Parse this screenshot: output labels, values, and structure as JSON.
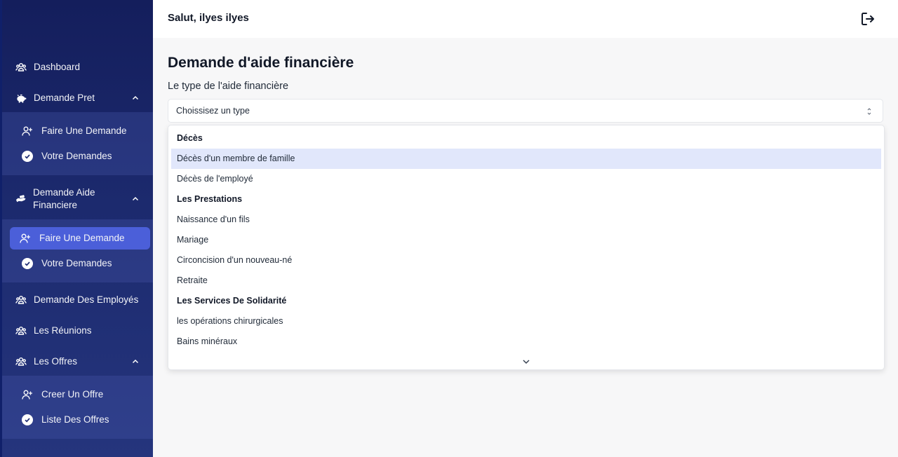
{
  "header": {
    "greeting": "Salut, ilyes ilyes",
    "logout_icon": "logout-icon"
  },
  "sidebar": {
    "items": [
      {
        "label": "Dashboard",
        "icon": "users-icon"
      },
      {
        "label": "Demande Pret",
        "icon": "piggy-bank-icon",
        "expanded": true
      },
      {
        "label": "Demande Aide Financiere",
        "icon": "hand-money-icon",
        "expanded": true
      },
      {
        "label": "Demande Des Employés",
        "icon": "users-icon"
      },
      {
        "label": "Les Réunions",
        "icon": "users-icon"
      },
      {
        "label": "Les Offres",
        "icon": "users-icon",
        "expanded": true
      }
    ],
    "pret_sub": [
      {
        "label": "Faire Une Demande",
        "icon": "user-plus-icon"
      },
      {
        "label": "Votre Demandes",
        "icon": "check-circle-icon"
      }
    ],
    "aide_sub": [
      {
        "label": "Faire Une Demande",
        "icon": "user-plus-icon",
        "active": true
      },
      {
        "label": "Votre Demandes",
        "icon": "check-circle-icon"
      }
    ],
    "offres_sub": [
      {
        "label": "Creer Un Offre",
        "icon": "user-plus-icon"
      },
      {
        "label": "Liste Des Offres",
        "icon": "check-circle-icon"
      }
    ]
  },
  "main": {
    "title": "Demande d'aide financière",
    "type_label": "Le type de l'aide financière",
    "select_value": "Choissisez un type",
    "options": [
      {
        "label": "Décès",
        "group": true
      },
      {
        "label": "Décès d'un membre de famille",
        "highlighted": true
      },
      {
        "label": "Décès de l'employé"
      },
      {
        "label": "Les Prestations",
        "group": true
      },
      {
        "label": "Naissance d'un fils"
      },
      {
        "label": "Mariage"
      },
      {
        "label": "Circoncision d'un nouveau-né"
      },
      {
        "label": "Retraite"
      },
      {
        "label": "Les Services De Solidarité",
        "group": true
      },
      {
        "label": "les opérations chirurgicales"
      },
      {
        "label": "Bains minéraux"
      }
    ]
  },
  "colors": {
    "sidebar_bg": "#1c2a6e",
    "active_item": "#4b5fd9",
    "option_highlight": "#e1e7fb"
  }
}
